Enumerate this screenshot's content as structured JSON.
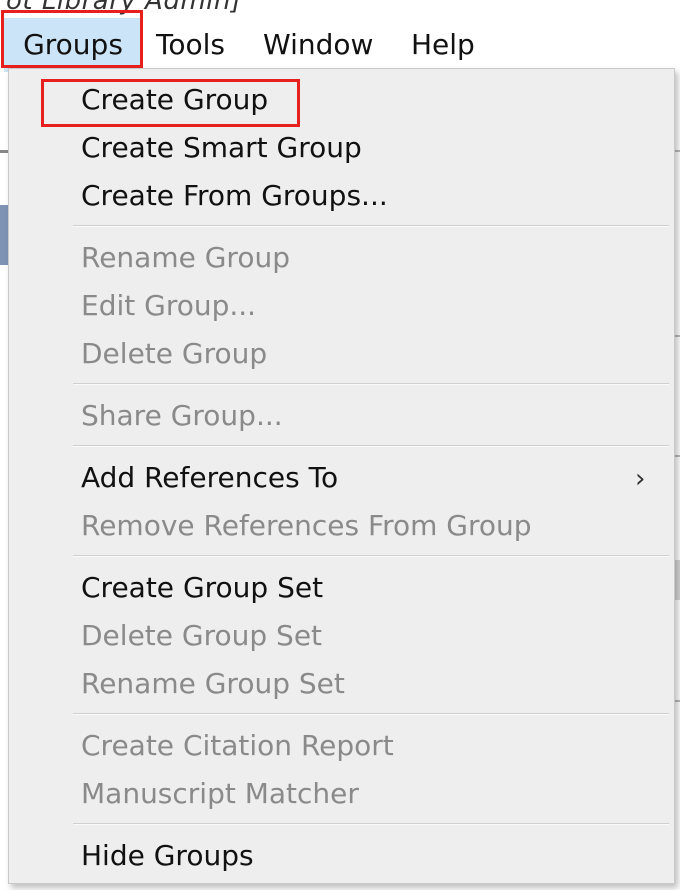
{
  "window": {
    "title_fragment": "ot Library Admin]"
  },
  "menubar": {
    "items": [
      {
        "label": "Groups"
      },
      {
        "label": "Tools"
      },
      {
        "label": "Window"
      },
      {
        "label": "Help"
      }
    ]
  },
  "groups_menu": {
    "items": [
      {
        "label": "Create Group",
        "enabled": true
      },
      {
        "label": "Create Smart Group",
        "enabled": true
      },
      {
        "label": "Create From Groups...",
        "enabled": true
      },
      {
        "label": "Rename Group",
        "enabled": false
      },
      {
        "label": "Edit Group...",
        "enabled": false
      },
      {
        "label": "Delete Group",
        "enabled": false
      },
      {
        "label": "Share Group...",
        "enabled": false
      },
      {
        "label": "Add References To",
        "enabled": true,
        "submenu": true
      },
      {
        "label": "Remove References From Group",
        "enabled": false
      },
      {
        "label": "Create Group Set",
        "enabled": true
      },
      {
        "label": "Delete Group Set",
        "enabled": false
      },
      {
        "label": "Rename Group Set",
        "enabled": false
      },
      {
        "label": "Create Citation Report",
        "enabled": false
      },
      {
        "label": "Manuscript Matcher",
        "enabled": false
      },
      {
        "label": "Hide Groups",
        "enabled": true
      }
    ],
    "submenu_arrow": "›"
  },
  "colors": {
    "highlight_box": "#e8201d",
    "active_menu_bg": "#cce4f7",
    "disabled_text": "#8a8a8a"
  }
}
